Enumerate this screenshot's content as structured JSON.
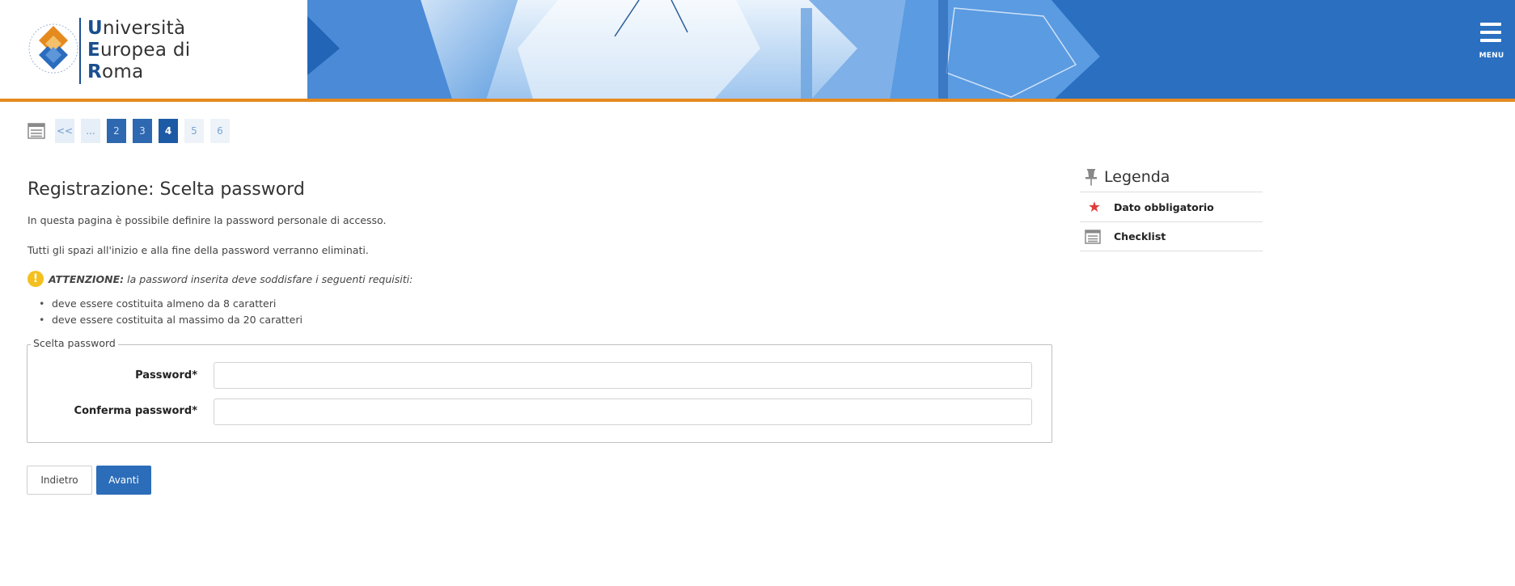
{
  "header": {
    "logo": {
      "line1_cap": "U",
      "line1_rest": "niversità",
      "line2_cap": "E",
      "line2_rest": "uropea di",
      "line3_cap": "R",
      "line3_rest": "oma"
    },
    "menu_label": "MENU",
    "colors": {
      "brand_blue": "#1b4f8f",
      "header_blue": "#2a6fc0",
      "accent_orange": "#e58a1f"
    }
  },
  "pager": {
    "icon": "checklist-icon",
    "items": [
      {
        "label": "<<",
        "state": "nav"
      },
      {
        "label": "...",
        "state": "dots"
      },
      {
        "label": "2",
        "state": "done"
      },
      {
        "label": "3",
        "state": "done"
      },
      {
        "label": "4",
        "state": "current"
      },
      {
        "label": "5",
        "state": "future"
      },
      {
        "label": "6",
        "state": "future"
      }
    ]
  },
  "main": {
    "title": "Registrazione: Scelta password",
    "intro": "In questa pagina è possibile definire la password personale di accesso.",
    "spaces_note": "Tutti gli spazi all'inizio e alla fine della password verranno eliminati.",
    "warning": {
      "icon": "warning-icon",
      "strong": "ATTENZIONE:",
      "text": "la password inserita deve soddisfare i seguenti requisiti:"
    },
    "requirements": [
      "deve essere costituita almeno da 8 caratteri",
      "deve essere costituita al massimo da 20 caratteri"
    ]
  },
  "form": {
    "legend": "Scelta password",
    "password_label": "Password*",
    "password_value": "",
    "confirm_label": "Conferma password*",
    "confirm_value": ""
  },
  "buttons": {
    "back_label": "Indietro",
    "next_label": "Avanti"
  },
  "legend_panel": {
    "title": "Legenda",
    "items": [
      {
        "icon": "required-star-icon",
        "label": "Dato obbligatorio"
      },
      {
        "icon": "checklist-icon",
        "label": "Checklist"
      }
    ]
  }
}
